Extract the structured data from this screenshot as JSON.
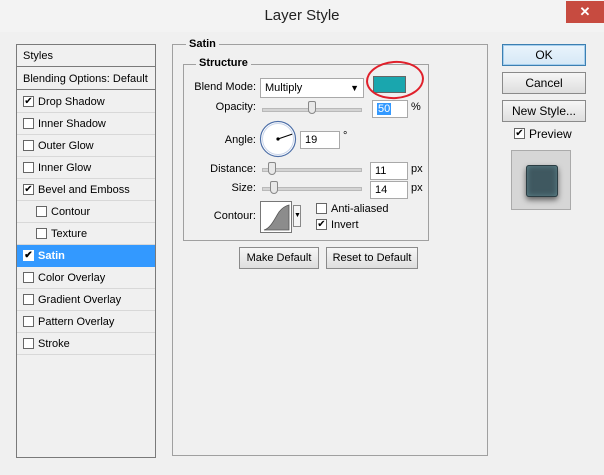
{
  "window": {
    "title": "Layer Style",
    "close_glyph": "✕"
  },
  "styles_panel": {
    "header": "Styles",
    "blending_options": "Blending Options: Default",
    "items": [
      {
        "label": "Drop Shadow",
        "checked": true,
        "indent": false,
        "selected": false
      },
      {
        "label": "Inner Shadow",
        "checked": false,
        "indent": false,
        "selected": false
      },
      {
        "label": "Outer Glow",
        "checked": false,
        "indent": false,
        "selected": false
      },
      {
        "label": "Inner Glow",
        "checked": false,
        "indent": false,
        "selected": false
      },
      {
        "label": "Bevel and Emboss",
        "checked": true,
        "indent": false,
        "selected": false
      },
      {
        "label": "Contour",
        "checked": false,
        "indent": true,
        "selected": false
      },
      {
        "label": "Texture",
        "checked": false,
        "indent": true,
        "selected": false
      },
      {
        "label": "Satin",
        "checked": true,
        "indent": false,
        "selected": true
      },
      {
        "label": "Color Overlay",
        "checked": false,
        "indent": false,
        "selected": false
      },
      {
        "label": "Gradient Overlay",
        "checked": false,
        "indent": false,
        "selected": false
      },
      {
        "label": "Pattern Overlay",
        "checked": false,
        "indent": false,
        "selected": false
      },
      {
        "label": "Stroke",
        "checked": false,
        "indent": false,
        "selected": false
      }
    ]
  },
  "satin": {
    "group_title": "Satin",
    "structure_title": "Structure",
    "blend_mode_label": "Blend Mode:",
    "blend_mode_value": "Multiply",
    "swatch_color": "#1aa6ae",
    "opacity_label": "Opacity:",
    "opacity_value": "50",
    "opacity_unit": "%",
    "opacity_fraction": 0.5,
    "angle_label": "Angle:",
    "angle_value": "19",
    "angle_unit": "°",
    "distance_label": "Distance:",
    "distance_value": "11",
    "distance_unit": "px",
    "size_label": "Size:",
    "size_value": "14",
    "size_unit": "px",
    "contour_label": "Contour:",
    "anti_aliased_label": "Anti-aliased",
    "anti_aliased_checked": false,
    "invert_label": "Invert",
    "invert_checked": true,
    "make_default": "Make Default",
    "reset_to_default": "Reset to Default"
  },
  "actions": {
    "ok": "OK",
    "cancel": "Cancel",
    "new_style": "New Style...",
    "preview_label": "Preview",
    "preview_checked": true
  },
  "highlight_color": "#e0202b",
  "selection_color": "#3399ff"
}
